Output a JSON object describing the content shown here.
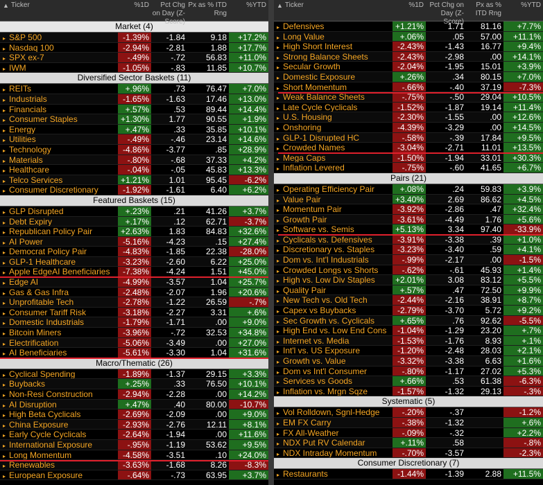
{
  "columns": {
    "ticker": "Ticker",
    "d1": "%1D",
    "zscore": "Pct Chg on Day (Z-Score)",
    "itd": "Px as % ITD Rng",
    "ytd": "%YTD"
  },
  "left": [
    {
      "section": "Market (4)",
      "rows": [
        [
          "S&P 500",
          "-1.39%",
          "-1.84",
          "9.18",
          "+17.2%"
        ],
        [
          "Nasdaq 100",
          "-2.94%",
          "-2.81",
          "1.88",
          "+17.7%"
        ],
        [
          "SPX ex-7",
          "-.49%",
          "-.72",
          "56.83",
          "+11.0%"
        ],
        [
          "IWM",
          "-1.05%",
          "-.83",
          "11.85",
          "+10.7%"
        ]
      ]
    },
    {
      "section": "Diversified Sector Baskets (11)",
      "rows": [
        [
          "REITs",
          "+.96%",
          ".73",
          "76.47",
          "+7.0%"
        ],
        [
          "Industrials",
          "-1.65%",
          "-1.63",
          "17.46",
          "+13.0%"
        ],
        [
          "Financials",
          "+.57%",
          ".53",
          "89.44",
          "+14.4%"
        ],
        [
          "Consumer Staples",
          "+1.30%",
          "1.77",
          "90.55",
          "+1.9%"
        ],
        [
          "Energy",
          "+.47%",
          ".33",
          "35.85",
          "+10.1%"
        ],
        [
          "Utilities",
          "-.49%",
          "-.46",
          "23.14",
          "+14.6%"
        ],
        [
          "Technology",
          "-4.86%",
          "-3.77",
          ".85",
          "+28.9%"
        ],
        [
          "Materials",
          "-.80%",
          "-.68",
          "37.33",
          "+4.2%"
        ],
        [
          "Healthcare",
          "-.04%",
          "-.05",
          "45.83",
          "+13.3%"
        ],
        [
          "Telco Services",
          "+1.21%",
          "1.01",
          "95.45",
          "-6.2%"
        ],
        [
          "Consumer Discretionary",
          "-1.92%",
          "-1.61",
          "6.40",
          "+6.2%"
        ]
      ]
    },
    {
      "section": "Featured Baskets (15)",
      "rows": [
        [
          "GLP Disrupted",
          "+.23%",
          ".21",
          "41.26",
          "+3.7%"
        ],
        [
          "Debt Expiry",
          "+.17%",
          ".12",
          "62.71",
          "-3.7%"
        ],
        [
          "Republican Policy Pair",
          "+2.63%",
          "1.83",
          "84.83",
          "+32.6%"
        ],
        [
          "AI Power",
          "-5.16%",
          "-4.23",
          ".15",
          "+27.4%"
        ],
        [
          "Democrat Policy Pair",
          "-4.83%",
          "-1.85",
          "22.38",
          "-28.0%"
        ],
        [
          "GLP-1 Healthcare",
          "-3.23%",
          "-2.60",
          "6.22",
          "+25.0%"
        ],
        [
          "Apple EdgeAI Beneficiaries",
          "-7.38%",
          "-4.24",
          "1.51",
          "+45.0%"
        ],
        [
          "Edge AI",
          "-4.99%",
          "-3.57",
          "1.04",
          "+25.7%"
        ],
        [
          "Gas & Gas Infra",
          "-2.48%",
          "-2.07",
          "1.96",
          "+20.6%"
        ],
        [
          "Unprofitable Tech",
          "-2.78%",
          "-1.22",
          "26.59",
          "-.7%"
        ],
        [
          "Consumer Tariff Risk",
          "-3.18%",
          "-2.27",
          "3.31",
          "+.6%"
        ],
        [
          "Domestic Industrials",
          "-1.79%",
          "-1.71",
          ".00",
          "+9.0%"
        ],
        [
          "Bitcoin Miners",
          "-3.96%",
          "-.72",
          "32.53",
          "+34.8%"
        ],
        [
          "Electrification",
          "-5.06%",
          "-3.49",
          ".00",
          "+27.0%"
        ],
        [
          "AI Beneficiaries",
          "-5.61%",
          "-3.30",
          "1.04",
          "+31.6%"
        ]
      ]
    },
    {
      "section": "Macro/Thematic (26)",
      "rows": [
        [
          "Cyclical Spending",
          "-1.89%",
          "-1.37",
          "29.15",
          "+3.3%"
        ],
        [
          "Buybacks",
          "+.25%",
          ".33",
          "76.50",
          "+10.1%"
        ],
        [
          "Non-Resi Construction",
          "-2.94%",
          "-2.28",
          ".00",
          "+14.2%"
        ],
        [
          "AI Disruption",
          "+.47%",
          ".40",
          "80.00",
          "-10.7%"
        ],
        [
          "High Beta Cyclicals",
          "-2.69%",
          "-2.09",
          ".00",
          "+9.0%"
        ],
        [
          "China Exposure",
          "-2.93%",
          "-2.76",
          "12.11",
          "+8.1%"
        ],
        [
          "Early Cycle Cyclicals",
          "-2.64%",
          "-1.94",
          ".00",
          "+11.6%"
        ],
        [
          "International Exposure",
          "-.95%",
          "-1.19",
          "53.62",
          "+9.5%"
        ],
        [
          "Long Momentum",
          "-4.58%",
          "-3.51",
          ".10",
          "+24.0%"
        ],
        [
          "Renewables",
          "-3.63%",
          "-1.68",
          "8.26",
          "-8.3%"
        ],
        [
          "European Exposure",
          "-.64%",
          "-.73",
          "63.95",
          "+3.7%"
        ]
      ]
    }
  ],
  "right": [
    {
      "section": "",
      "rows": [
        [
          "Defensives",
          "+1.21%",
          "1.71",
          "81.16",
          "+7.7%"
        ],
        [
          "Long Value",
          "+.06%",
          ".05",
          "57.00",
          "+11.1%"
        ],
        [
          "High Short Interest",
          "-2.43%",
          "-1.43",
          "16.77",
          "+9.4%"
        ],
        [
          "Strong Balance Sheets",
          "-2.43%",
          "-2.98",
          ".00",
          "+14.1%"
        ],
        [
          "Secular Growth",
          "-2.04%",
          "-1.95",
          "15.01",
          "+3.9%"
        ],
        [
          "Domestic Exposure",
          "+.26%",
          ".34",
          "80.15",
          "+7.0%"
        ],
        [
          "Short Momentum",
          "-.66%",
          "-.40",
          "37.19",
          "-7.3%"
        ],
        [
          "Weak Balance Sheets",
          "-.75%",
          "-.50",
          "29.04",
          "+10.5%"
        ],
        [
          "Late Cycle Cyclicals",
          "-1.52%",
          "-1.87",
          "19.14",
          "+11.4%"
        ],
        [
          "U.S. Housing",
          "-2.30%",
          "-1.55",
          ".00",
          "+12.6%"
        ],
        [
          "Onshoring",
          "-4.39%",
          "-3.29",
          ".00",
          "+14.5%"
        ],
        [
          "GLP-1 Disrupted HC",
          "-.58%",
          "-.39",
          "17.84",
          "+9.5%"
        ],
        [
          "Crowded Names",
          "-3.04%",
          "-2.71",
          "11.01",
          "+13.5%"
        ],
        [
          "Mega Caps",
          "-1.50%",
          "-1.94",
          "33.01",
          "+30.3%"
        ],
        [
          "Inflation Levered",
          "-.75%",
          "-.60",
          "41.65",
          "+6.7%"
        ]
      ]
    },
    {
      "section": "Pairs (21)",
      "rows": [
        [
          "Operating Efficiency Pair",
          "+.08%",
          ".24",
          "59.83",
          "+3.9%"
        ],
        [
          "Value Pair",
          "+3.40%",
          "2.69",
          "86.62",
          "+4.5%"
        ],
        [
          "Momentum Pair",
          "-3.92%",
          "-2.86",
          ".47",
          "+32.4%"
        ],
        [
          "Growth Pair",
          "-3.61%",
          "-4.49",
          "1.76",
          "+5.6%"
        ],
        [
          "Software vs. Semis",
          "+5.13%",
          "3.34",
          "97.40",
          "-33.9%"
        ],
        [
          "Cyclicals vs. Defensives",
          "-3.91%",
          "-3.38",
          ".39",
          "+1.0%"
        ],
        [
          "Discretionary vs. Staples",
          "-3.23%",
          "-3.40",
          ".59",
          "+4.1%"
        ],
        [
          "Dom vs. Int'l Industrials",
          "-.99%",
          "-2.17",
          ".00",
          "-1.5%"
        ],
        [
          "Crowded Longs vs Shorts",
          "-.62%",
          "-.61",
          "45.93",
          "+1.4%"
        ],
        [
          "High vs. Low Div Staples",
          "+2.01%",
          "3.08",
          "83.12",
          "+5.5%"
        ],
        [
          "Quality Pair",
          "+.57%",
          ".47",
          "72.50",
          "+9.9%"
        ],
        [
          "New Tech vs. Old Tech",
          "-2.44%",
          "-2.16",
          "38.91",
          "+8.7%"
        ],
        [
          "Capex vs Buybacks",
          "-2.79%",
          "-3.70",
          "5.72",
          "+9.2%"
        ],
        [
          "Sec Growth vs. Cyclicals",
          "+.65%",
          ".76",
          "92.62",
          "-5.5%"
        ],
        [
          "High End vs. Low End Cons",
          "-1.04%",
          "-1.29",
          "23.20",
          "+.7%"
        ],
        [
          "Internet vs. Media",
          "-1.53%",
          "-1.76",
          "8.93",
          "+.1%"
        ],
        [
          "Int'l vs. US Exposure",
          "-1.20%",
          "-2.48",
          "28.03",
          "+2.1%"
        ],
        [
          "Growth vs. Value",
          "-3.32%",
          "-3.38",
          "6.63",
          "+1.6%"
        ],
        [
          "Dom vs Int'l Consumer",
          "-.80%",
          "-1.17",
          "27.02",
          "+5.3%"
        ],
        [
          "Services vs Goods",
          "+.66%",
          ".53",
          "61.38",
          "-6.3%"
        ],
        [
          "Inflation vs. Mrgn Sqze",
          "-1.57%",
          "-1.32",
          "29.13",
          "-.3%"
        ]
      ]
    },
    {
      "section": "Systematic (5)",
      "rows": [
        [
          "Vol Rolldown, Sgnl-Hedge",
          "-.20%",
          "-.37",
          "",
          "-1.2%"
        ],
        [
          "EM FX Carry",
          "-.38%",
          "-1.32",
          "",
          "+.6%"
        ],
        [
          "FX All-Weather",
          "-.09%",
          "-.32",
          "",
          "+2.2%"
        ],
        [
          "NDX Put RV Calendar",
          "+.11%",
          ".58",
          "",
          "-.8%"
        ],
        [
          "NDX Intraday Momentum",
          "-.70%",
          "-3.57",
          "",
          "-2.3%"
        ]
      ]
    },
    {
      "section": "Consumer Discretionary (7)",
      "rows": [
        [
          "Restaurants",
          "-1.44%",
          "-1.39",
          "2.88",
          "+11.5%"
        ]
      ]
    }
  ],
  "arrows": {
    "row": "▸",
    "header": "▲"
  },
  "colors": {
    "ticker": "#f5a623",
    "positive_bg": "#1f6e1f",
    "negative_bg": "#8c1212",
    "section_bg": "#dadada",
    "highlight_line": "#e0202c"
  },
  "annotations": {
    "left_red_lines_after": [
      "Apple EdgeAI Beneficiaries",
      "AI Beneficiaries",
      "Long Momentum"
    ],
    "right_red_lines_after": [
      "Short Momentum",
      "Crowded Names",
      "Software vs. Semis"
    ]
  }
}
